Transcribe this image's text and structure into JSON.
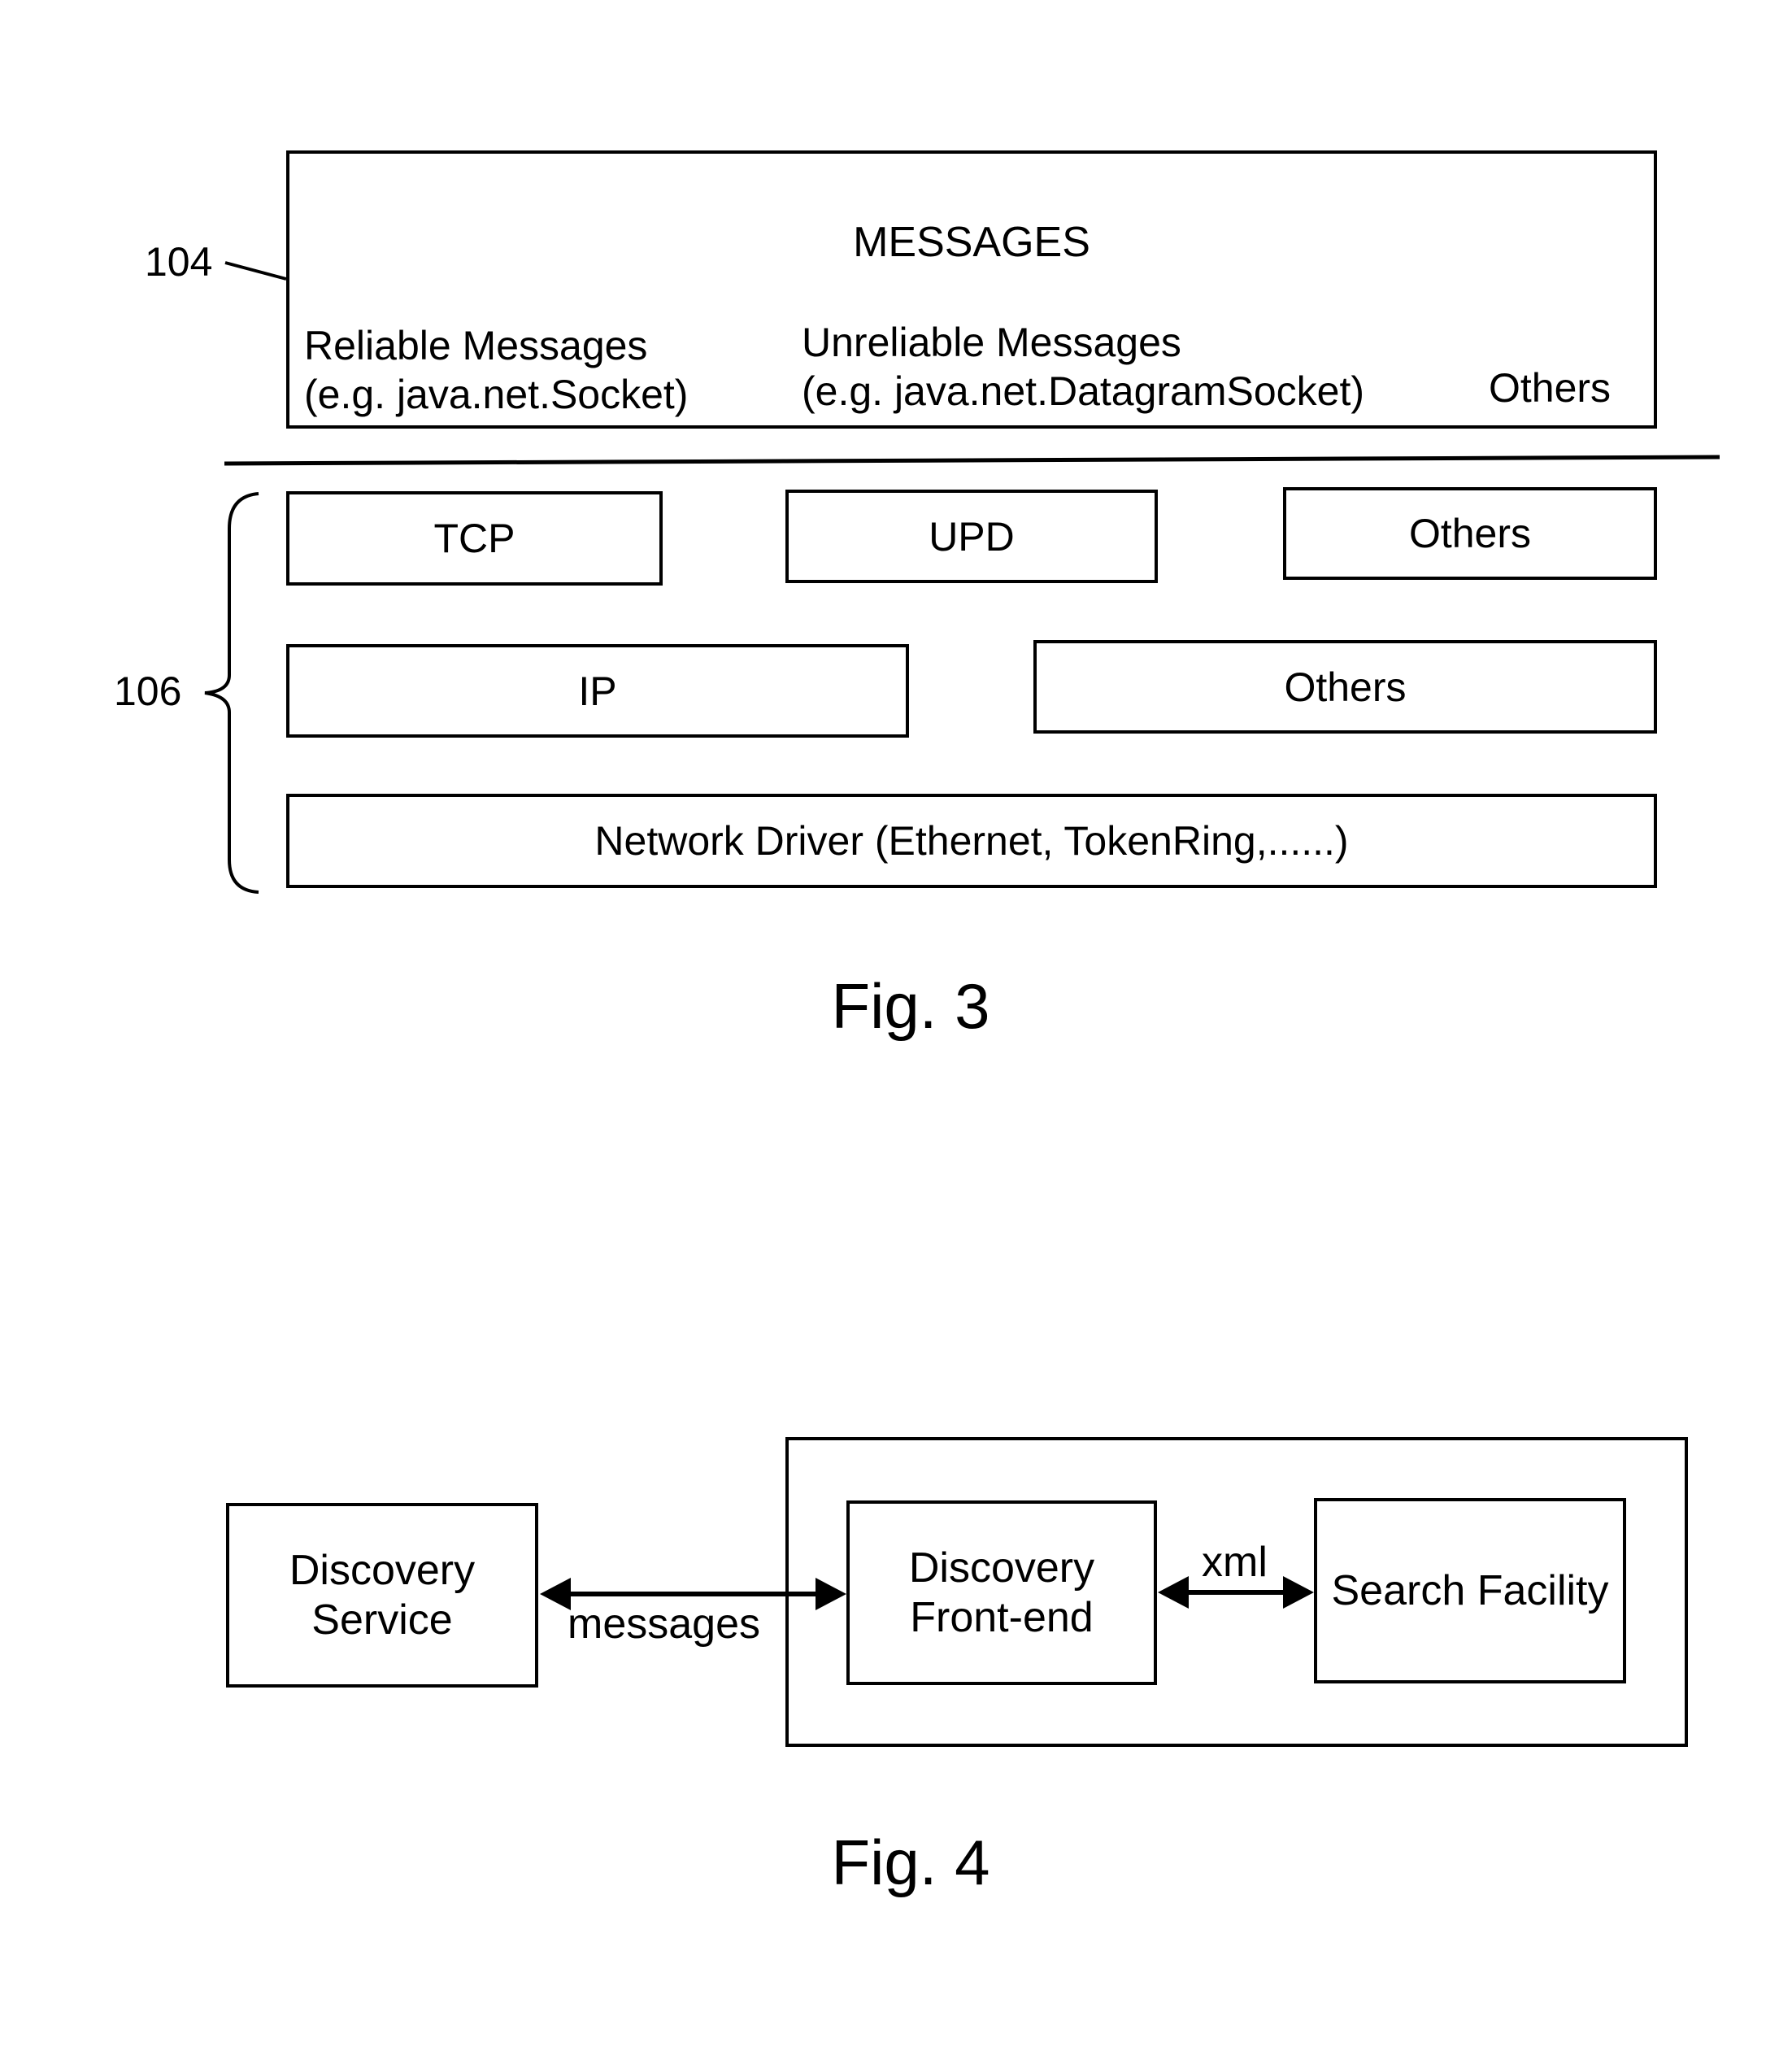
{
  "fig3": {
    "caption": "Fig. 3",
    "ref_104": "104",
    "ref_106": "106",
    "messages_box": {
      "title": "MESSAGES",
      "reliable_line1": "Reliable Messages",
      "reliable_line2": "(e.g. java.net.Socket)",
      "unreliable_line1": "Unreliable Messages",
      "unreliable_line2": "(e.g. java.net.DatagramSocket)",
      "others": "Others"
    },
    "layers": {
      "tcp": "TCP",
      "upd": "UPD",
      "others_transport": "Others",
      "ip": "IP",
      "others_network": "Others",
      "network_driver": "Network Driver (Ethernet, TokenRing,......)"
    }
  },
  "fig4": {
    "caption": "Fig. 4",
    "discovery_service_line1": "Discovery",
    "discovery_service_line2": "Service",
    "messages_label": "messages",
    "frontend_line1": "Discovery",
    "frontend_line2": "Front-end",
    "xml_label": "xml",
    "search_facility": "Search Facility"
  }
}
